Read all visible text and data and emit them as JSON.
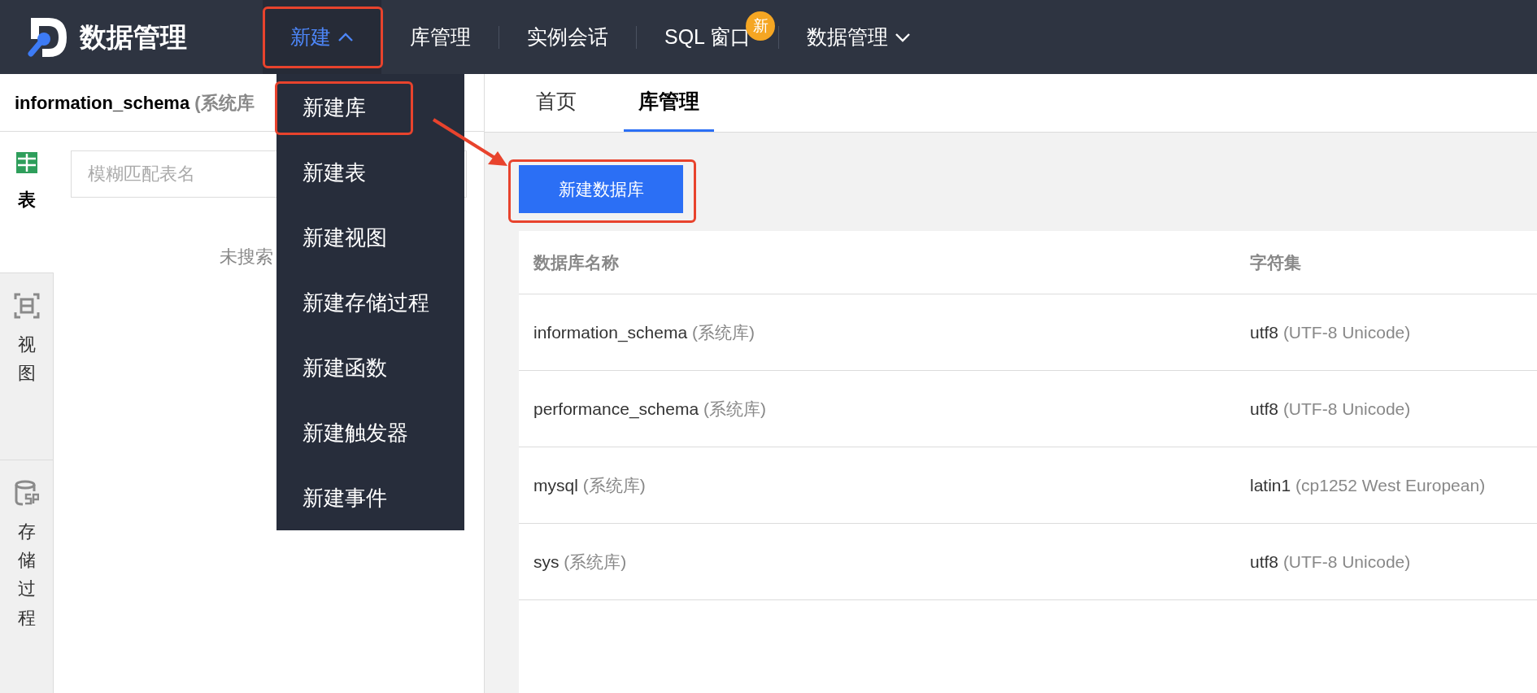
{
  "app": {
    "title": "数据管理"
  },
  "nav": [
    {
      "label": "新建",
      "kind": "dropdown",
      "selected": true,
      "expanded": true
    },
    {
      "label": "库管理",
      "kind": "link",
      "selected": false
    },
    {
      "label": "实例会话",
      "kind": "link",
      "selected": false
    },
    {
      "label": "SQL 窗口",
      "kind": "link",
      "selected": false,
      "badge": "新"
    },
    {
      "label": "数据管理",
      "kind": "dropdown",
      "selected": false,
      "expanded": false
    }
  ],
  "dropdown_menu": {
    "items": [
      {
        "label": "新建库"
      },
      {
        "label": "新建表"
      },
      {
        "label": "新建视图"
      },
      {
        "label": "新建存储过程"
      },
      {
        "label": "新建函数"
      },
      {
        "label": "新建触发器"
      },
      {
        "label": "新建事件"
      }
    ]
  },
  "left_panel": {
    "db_name": "information_schema",
    "db_note": "(系统库",
    "search": {
      "placeholder": "模糊匹配表名"
    },
    "empty_text": "未搜索",
    "side_tabs": [
      {
        "label": "表",
        "kind": "table",
        "selected": true
      },
      {
        "label": "视图",
        "kind": "view",
        "selected": false
      },
      {
        "label": "存储过程",
        "kind": "procedure",
        "selected": false
      }
    ]
  },
  "tabs": [
    {
      "label": "首页",
      "selected": false
    },
    {
      "label": "库管理",
      "selected": true
    }
  ],
  "create_button": "新建数据库",
  "table": {
    "columns": [
      "数据库名称",
      "字符集"
    ],
    "rows": [
      {
        "name": "information_schema",
        "note": "(系统库)",
        "charset": "utf8",
        "charset_note": "(UTF-8 Unicode)"
      },
      {
        "name": "performance_schema",
        "note": "(系统库)",
        "charset": "utf8",
        "charset_note": "(UTF-8 Unicode)"
      },
      {
        "name": "mysql",
        "note": "(系统库)",
        "charset": "latin1",
        "charset_note": "(cp1252 West European)"
      },
      {
        "name": "sys",
        "note": "(系统库)",
        "charset": "utf8",
        "charset_note": "(UTF-8 Unicode)"
      }
    ]
  }
}
